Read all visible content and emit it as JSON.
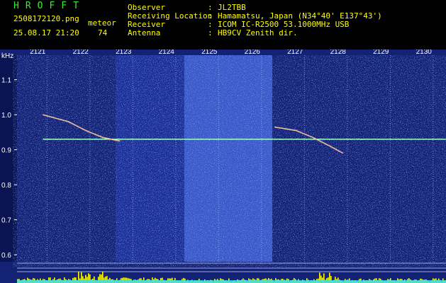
{
  "header": {
    "app_title": "HROFFT",
    "filename": "2508172120.png",
    "datetime": "25.08.17 21:20",
    "count_label": "meteor",
    "count_value": "74",
    "info": [
      {
        "label": "Observer",
        "value": "JL2TBB"
      },
      {
        "label": "Receiving Location",
        "value": "Hamamatsu, Japan (N34°40' E137°43')"
      },
      {
        "label": "Receiver",
        "value": "ICOM IC-R2500 53.1000MHz USB"
      },
      {
        "label": "Antenna",
        "value": "HB9CV Zenith dir."
      }
    ]
  },
  "chart_data": {
    "type": "heatmap",
    "ylabel": "kHz",
    "x_ticks": [
      "2121",
      "2122",
      "2123",
      "2124",
      "2125",
      "2126",
      "2127",
      "2128",
      "2129",
      "2130"
    ],
    "y_ticks": [
      "1.1",
      "1.0",
      "0.9",
      "0.8",
      "0.7",
      "0.6"
    ],
    "xlim": [
      2120.3,
      2130.3
    ],
    "ylim": [
      0.58,
      1.17
    ],
    "carrier_freq_khz": 0.93,
    "meteor_traces": [
      {
        "x": [
          2120.9,
          2121.5,
          2121.9,
          2122.3,
          2122.7
        ],
        "y": [
          1.0,
          0.98,
          0.955,
          0.935,
          0.925
        ]
      },
      {
        "x": [
          2126.3,
          2126.8,
          2127.2,
          2127.6,
          2127.9
        ],
        "y": [
          0.965,
          0.955,
          0.935,
          0.91,
          0.89
        ]
      }
    ],
    "bright_band": [
      2124.2,
      2126.25
    ],
    "colors": {
      "background": "#1a2a8a",
      "noise": "#3366ff",
      "trace": "#ffff88",
      "carrier": "#a0ffd0",
      "grid": "#c8c8ff",
      "activity": "#ffff00"
    }
  }
}
